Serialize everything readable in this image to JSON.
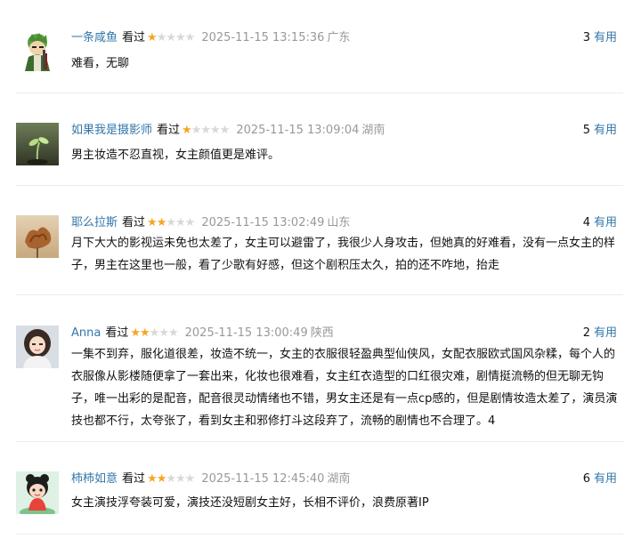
{
  "comments": [
    {
      "author": "一条咸鱼",
      "status": "看过",
      "rating": 1,
      "time": "2025-11-15 13:15:36",
      "location": "广东",
      "votes": "3",
      "useful_label": "有用",
      "content": "难看，无聊",
      "avatar_icon": "zoro-cartoon-avatar"
    },
    {
      "author": "如果我是摄影师",
      "status": "看过",
      "rating": 1,
      "time": "2025-11-15 13:09:04",
      "location": "湖南",
      "votes": "5",
      "useful_label": "有用",
      "content": "男主妆造不忍直视，女主颜值更是难评。",
      "avatar_icon": "plant-sprout-avatar"
    },
    {
      "author": "耶么拉斯",
      "status": "看过",
      "rating": 2,
      "time": "2025-11-15 13:02:49",
      "location": "山东",
      "votes": "4",
      "useful_label": "有用",
      "content": "月下大大的影视运未免也太差了，女主可以避雷了，我很少人身攻击，但她真的好难看，没有一点女主的样子，男主在这里也一般，看了少歌有好感，但这个剧积压太久，拍的还不咋地，抬走",
      "avatar_icon": "flower-photo-avatar"
    },
    {
      "author": "Anna",
      "status": "看过",
      "rating": 2,
      "time": "2025-11-15 13:00:49",
      "location": "陕西",
      "votes": "2",
      "useful_label": "有用",
      "content": "一集不到弃，服化道很差，妆造不统一，女主的衣服很轻盈典型仙侠风，女配衣服欧式国风杂糅，每个人的衣服像从影楼随便拿了一套出来，化妆也很难看，女主红衣造型的口红很灾难，剧情挺流畅的但无聊无钩子，唯一出彩的是配音，配音很灵动情绪也不错，男女主还是有一点cp感的，但是剧情妆造太差了，演员演技也都不行，太夸张了，看到女主和邪修打斗这段弃了，流畅的剧情也不合理了。4",
      "avatar_icon": "girl-portrait-avatar"
    },
    {
      "author": "柿柿如意",
      "status": "看过",
      "rating": 2,
      "time": "2025-11-15 12:45:40",
      "location": "湖南",
      "votes": "6",
      "useful_label": "有用",
      "content": "女主演技浮夸装可爱，演技还没短剧女主好，长相不评价，浪费原著IP",
      "avatar_icon": "cartoon-child-avatar"
    }
  ],
  "colors": {
    "link": "#3377aa",
    "star_on": "#f5a623",
    "star_off": "#d8d8d8",
    "muted": "#999999"
  }
}
